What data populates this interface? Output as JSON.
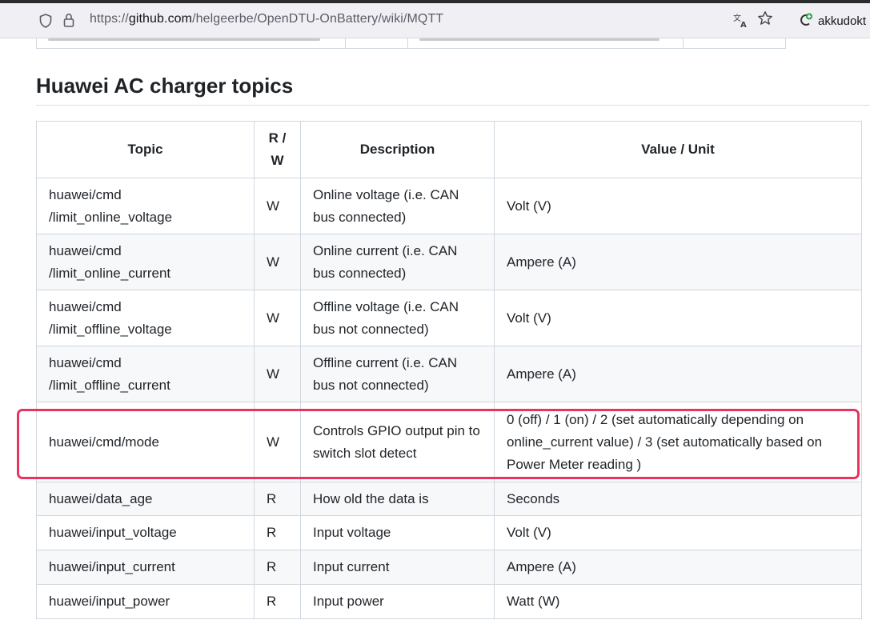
{
  "browser": {
    "url_prefix": "https://",
    "url_domain": "github.com",
    "url_path": "/helgeerbe/OpenDTU-OnBattery/wiki/MQTT",
    "extension_label": "akkudokt"
  },
  "section": {
    "title": "Huawei AC charger topics"
  },
  "table": {
    "headers": [
      "Topic",
      "R / W",
      "Description",
      "Value / Unit"
    ],
    "rows": [
      {
        "topic": "huawei/cmd /limit_online_voltage",
        "rw": "W",
        "description": "Online voltage (i.e. CAN bus connected)",
        "value": "Volt (V)"
      },
      {
        "topic": "huawei/cmd /limit_online_current",
        "rw": "W",
        "description": "Online current (i.e. CAN bus connected)",
        "value": "Ampere (A)"
      },
      {
        "topic": "huawei/cmd /limit_offline_voltage",
        "rw": "W",
        "description": "Offline voltage (i.e. CAN bus not connected)",
        "value": "Volt (V)"
      },
      {
        "topic": "huawei/cmd /limit_offline_current",
        "rw": "W",
        "description": "Offline current (i.e. CAN bus not connected)",
        "value": "Ampere (A)"
      },
      {
        "topic": "huawei/cmd/mode",
        "rw": "W",
        "description": "Controls GPIO output pin to switch slot detect",
        "value": "0 (off) / 1 (on) / 2 (set automatically depending on online_current value) / 3 (set automatically based on Power Meter reading )"
      },
      {
        "topic": "huawei/data_age",
        "rw": "R",
        "description": "How old the data is",
        "value": "Seconds"
      },
      {
        "topic": "huawei/input_voltage",
        "rw": "R",
        "description": "Input voltage",
        "value": "Volt (V)"
      },
      {
        "topic": "huawei/input_current",
        "rw": "R",
        "description": "Input current",
        "value": "Ampere (A)"
      },
      {
        "topic": "huawei/input_power",
        "rw": "R",
        "description": "Input power",
        "value": "Watt (W)"
      }
    ]
  },
  "highlight_color": "#e8345f"
}
